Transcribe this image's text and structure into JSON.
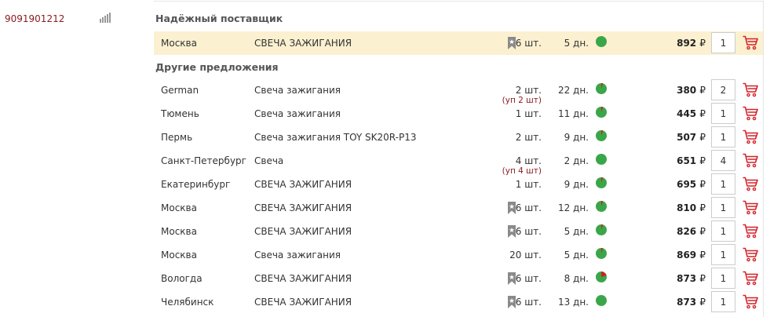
{
  "article": "9091901212",
  "sections": {
    "reliable": "Надёжный поставщик",
    "other": "Другие предложения"
  },
  "reliable_offer": {
    "city": "Москва",
    "desc": "СВЕЧА ЗАЖИГАНИЯ",
    "qty": "6 шт.",
    "days": "5 дн.",
    "price": "892",
    "input": "1",
    "bookmark": true,
    "pie_fraction": 0.0
  },
  "currency": "₽",
  "offers": [
    {
      "city": "German",
      "desc": "Свеча зажигания",
      "qty": "2 шт.",
      "note": "(уп 2 шт)",
      "days": "22 дн.",
      "price": "380",
      "input": "2",
      "bookmark": false,
      "pie_fraction": 0.05
    },
    {
      "city": "Тюмень",
      "desc": "Свеча зажигания",
      "qty": "1 шт.",
      "note": "",
      "days": "11 дн.",
      "price": "445",
      "input": "1",
      "bookmark": false,
      "pie_fraction": 0.05
    },
    {
      "city": "Пермь",
      "desc": "Свеча зажигания TOY SK20R-P13",
      "qty": "2 шт.",
      "note": "",
      "days": "9 дн.",
      "price": "507",
      "input": "1",
      "bookmark": false,
      "pie_fraction": 0.05
    },
    {
      "city": "Санкт-Петербург",
      "desc": "Свеча",
      "qty": "4 шт.",
      "note": "(уп 4 шт)",
      "days": "2 дн.",
      "price": "651",
      "input": "4",
      "bookmark": false,
      "pie_fraction": 0.0
    },
    {
      "city": "Екатеринбург",
      "desc": "СВЕЧА ЗАЖИГАНИЯ",
      "qty": "1 шт.",
      "note": "",
      "days": "9 дн.",
      "price": "695",
      "input": "1",
      "bookmark": false,
      "pie_fraction": 0.05
    },
    {
      "city": "Москва",
      "desc": "СВЕЧА ЗАЖИГАНИЯ",
      "qty": "6 шт.",
      "note": "",
      "days": "12 дн.",
      "price": "810",
      "input": "1",
      "bookmark": true,
      "pie_fraction": 0.05
    },
    {
      "city": "Москва",
      "desc": "СВЕЧА ЗАЖИГАНИЯ",
      "qty": "6 шт.",
      "note": "",
      "days": "5 дн.",
      "price": "826",
      "input": "1",
      "bookmark": true,
      "pie_fraction": 0.05
    },
    {
      "city": "Москва",
      "desc": "Свеча зажигания",
      "qty": "20 шт.",
      "note": "",
      "days": "5 дн.",
      "price": "869",
      "input": "1",
      "bookmark": false,
      "pie_fraction": 0.05
    },
    {
      "city": "Вологда",
      "desc": "СВЕЧА ЗАЖИГАНИЯ",
      "qty": "6 шт.",
      "note": "",
      "days": "8 дн.",
      "price": "873",
      "input": "1",
      "bookmark": true,
      "pie_fraction": 0.2
    },
    {
      "city": "Челябинск",
      "desc": "СВЕЧА ЗАЖИГАНИЯ",
      "qty": "6 шт.",
      "note": "",
      "days": "13 дн.",
      "price": "873",
      "input": "1",
      "bookmark": true,
      "pie_fraction": 0.0
    }
  ],
  "colors": {
    "highlight": "#fbf0d0",
    "pie_green": "#3aa64a",
    "pie_red": "#d0201c",
    "cart": "#d2232a",
    "bookmark": "#8a8a8a"
  }
}
